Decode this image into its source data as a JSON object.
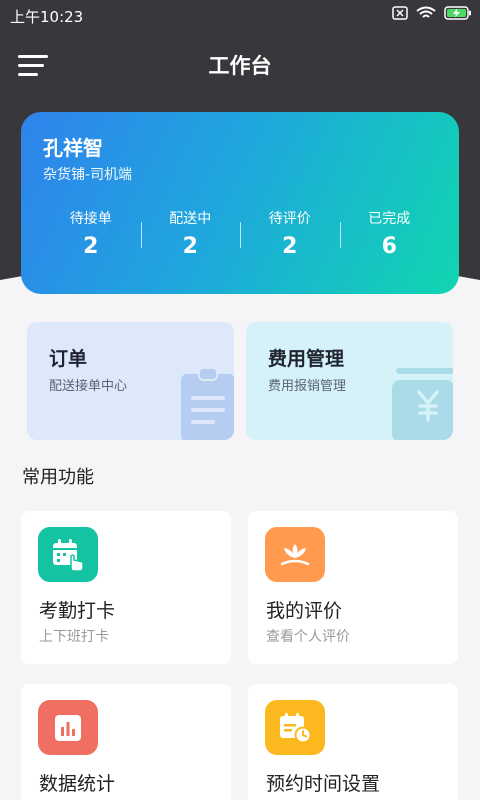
{
  "status_bar": {
    "time": "上午10:23"
  },
  "header": {
    "title": "工作台"
  },
  "profile": {
    "name": "孔祥智",
    "subtitle": "杂货铺-司机端",
    "stats": [
      {
        "label": "待接单",
        "value": "2"
      },
      {
        "label": "配送中",
        "value": "2"
      },
      {
        "label": "待评价",
        "value": "2"
      },
      {
        "label": "已完成",
        "value": "6"
      }
    ]
  },
  "entries": [
    {
      "title": "订单",
      "desc": "配送接单中心",
      "icon": "clipboard-icon",
      "color": "#b6cdf2"
    },
    {
      "title": "费用管理",
      "desc": "费用报销管理",
      "icon": "yen-wallet-icon",
      "color": "#a9dbe8"
    }
  ],
  "section": {
    "title": "常用功能"
  },
  "features": [
    {
      "title": "考勤打卡",
      "desc": "上下班打卡",
      "icon": "calendar-tap-icon",
      "color": "#14c3a2"
    },
    {
      "title": "我的评价",
      "desc": "查看个人评价",
      "icon": "flower-icon",
      "color": "#ff9a4f"
    },
    {
      "title": "数据统计",
      "desc": "",
      "icon": "bar-chart-icon",
      "color": "#ef6f63"
    },
    {
      "title": "预约时间设置",
      "desc": "",
      "icon": "calendar-clock-icon",
      "color": "#fcb91f"
    }
  ]
}
